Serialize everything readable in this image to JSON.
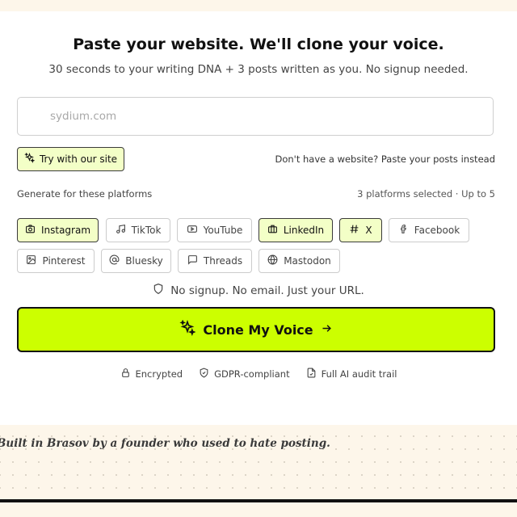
{
  "hero": {
    "title": "Paste your website. We'll clone your voice.",
    "subtitle": "30 seconds to your writing DNA + 3 posts written as you. No signup needed."
  },
  "url_input": {
    "placeholder": "sydium.com",
    "value": ""
  },
  "try_button": {
    "label": "Try with our site",
    "icon": "sparkles-icon"
  },
  "paste_link": {
    "label": "Don't have a website? Paste your posts instead"
  },
  "platforms": {
    "label": "Generate for these platforms",
    "count_text": "3 platforms selected · Up to 5",
    "items": [
      {
        "label": "Instagram",
        "icon": "instagram-icon",
        "selected": true
      },
      {
        "label": "TikTok",
        "icon": "tiktok-icon",
        "selected": false
      },
      {
        "label": "YouTube",
        "icon": "youtube-icon",
        "selected": false
      },
      {
        "label": "LinkedIn",
        "icon": "linkedin-icon",
        "selected": true
      },
      {
        "label": "X",
        "icon": "hash-icon",
        "selected": true
      },
      {
        "label": "Facebook",
        "icon": "facebook-icon",
        "selected": false
      },
      {
        "label": "Pinterest",
        "icon": "image-icon",
        "selected": false
      },
      {
        "label": "Bluesky",
        "icon": "at-icon",
        "selected": false
      },
      {
        "label": "Threads",
        "icon": "message-icon",
        "selected": false
      },
      {
        "label": "Mastodon",
        "icon": "globe-icon",
        "selected": false
      }
    ]
  },
  "reassurance": {
    "text": "No signup. No email. Just your URL.",
    "icon": "shield-icon"
  },
  "clone_button": {
    "label": "Clone My Voice",
    "icon": "sparkles-icon",
    "arrow": "arrow-right-icon"
  },
  "trust_badges": [
    {
      "label": "Encrypted",
      "icon": "lock-icon"
    },
    {
      "label": "GDPR-compliant",
      "icon": "shield-check-icon"
    },
    {
      "label": "Full AI audit trail",
      "icon": "file-check-icon"
    }
  ],
  "footer": {
    "tagline": "Built in Brasov by a founder who used to hate posting."
  },
  "colors": {
    "accent": "#ccff00",
    "selected_chip": "#f3ffc7",
    "page_bg": "#fdf6ea"
  }
}
